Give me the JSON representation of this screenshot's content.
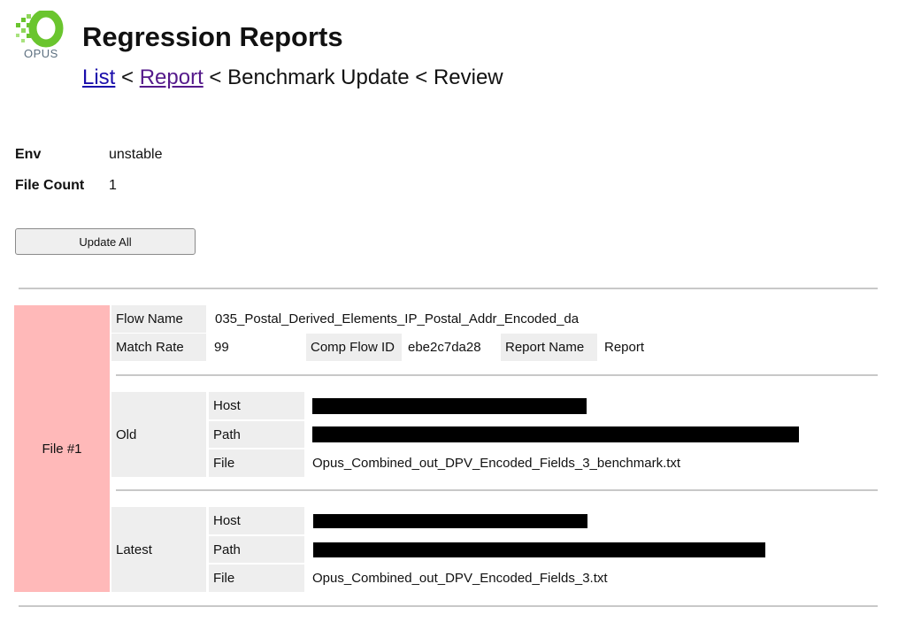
{
  "brand": {
    "logo_text": "OPUS",
    "accent_color": "#6ac52e"
  },
  "page": {
    "title": "Regression Reports"
  },
  "breadcrumb": {
    "list": "List",
    "sep1": " < ",
    "report": "Report",
    "sep2": " < ",
    "benchmark": "Benchmark Update",
    "sep3": " < ",
    "review": "Review"
  },
  "meta": {
    "env_label": "Env",
    "env_value": "unstable",
    "file_count_label": "File Count",
    "file_count_value": "1"
  },
  "actions": {
    "update_all": "Update All"
  },
  "file": {
    "label": "File #1",
    "flow_name_label": "Flow Name",
    "flow_name_value": "035_Postal_Derived_Elements_IP_Postal_Addr_Encoded_da",
    "match_rate_label": "Match Rate",
    "match_rate_value": "99",
    "comp_flow_id_label": "Comp Flow ID",
    "comp_flow_id_value": "ebe2c7da28",
    "report_name_label": "Report Name",
    "report_name_value": "Report",
    "old": {
      "label": "Old",
      "host_label": "Host",
      "path_label": "Path",
      "file_label": "File",
      "file_value": "Opus_Combined_out_DPV_Encoded_Fields_3_benchmark.txt"
    },
    "latest": {
      "label": "Latest",
      "host_label": "Host",
      "path_label": "Path",
      "file_label": "File",
      "file_value": "Opus_Combined_out_DPV_Encoded_Fields_3.txt"
    }
  }
}
